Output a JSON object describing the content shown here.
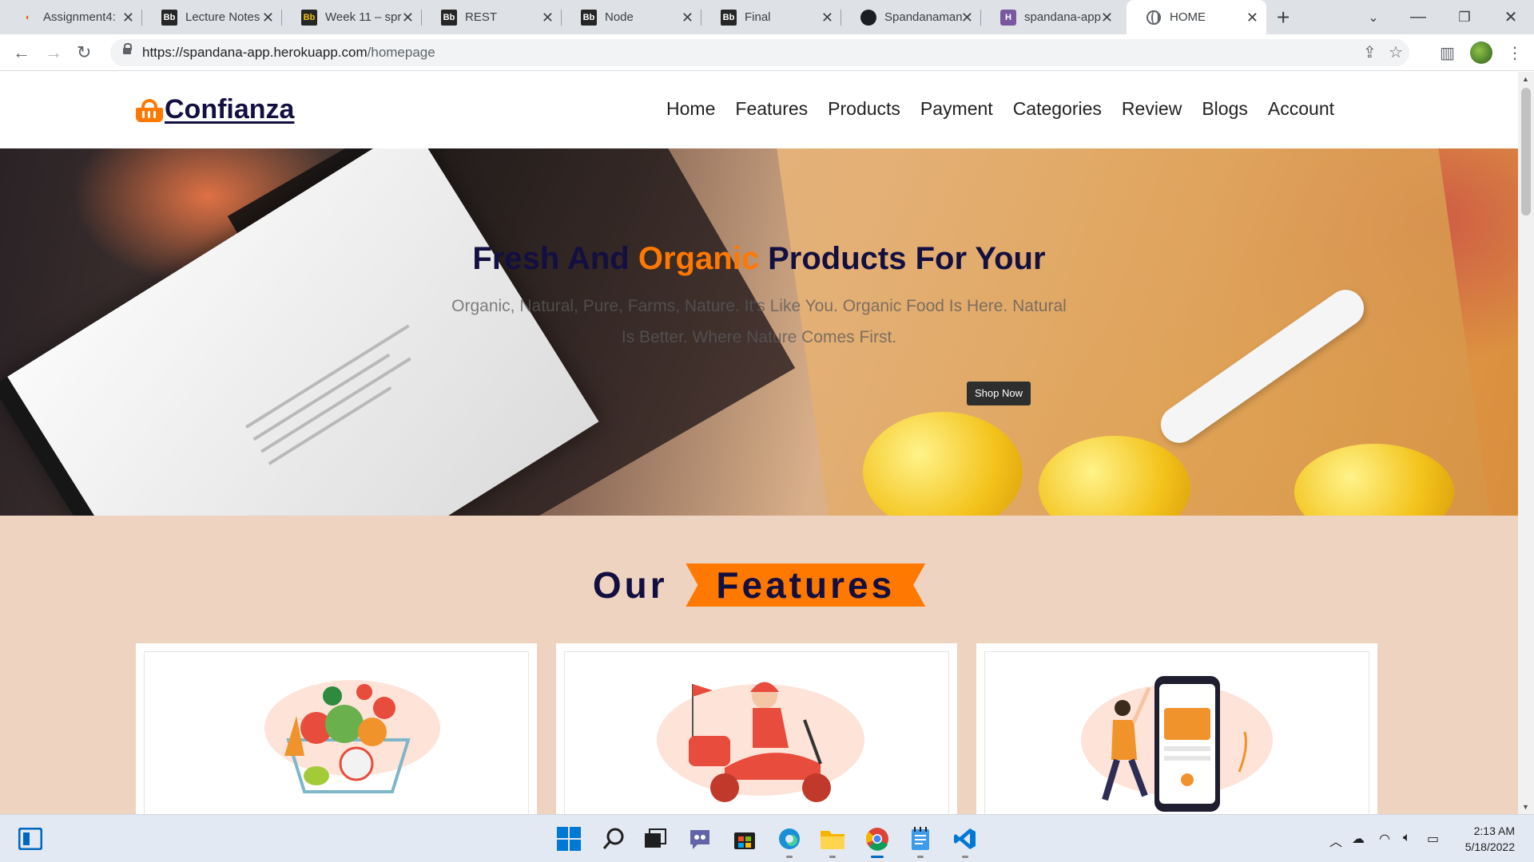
{
  "browser": {
    "tabs": [
      {
        "title": "Assignment4:",
        "icon": "udacity-icon"
      },
      {
        "title": "Lecture Notes",
        "icon": "blackboard-icon"
      },
      {
        "title": "Week 11 – spr",
        "icon": "blackboard-icon"
      },
      {
        "title": "REST",
        "icon": "blackboard-icon"
      },
      {
        "title": "Node",
        "icon": "blackboard-icon"
      },
      {
        "title": "Final",
        "icon": "blackboard-icon"
      },
      {
        "title": "Spandanaman",
        "icon": "github-icon"
      },
      {
        "title": "spandana-app",
        "icon": "heroku-icon"
      },
      {
        "title": "HOME",
        "icon": "globe-icon",
        "active": true
      }
    ],
    "url_host": "https://spandana-app.herokuapp.com",
    "url_path": "/homepage"
  },
  "site": {
    "logo": "Confianza",
    "nav": [
      "Home",
      "Features",
      "Products",
      "Payment",
      "Categories",
      "Review",
      "Blogs",
      "Account"
    ],
    "hero": {
      "title_part1": "Fresh And ",
      "title_accent": "Organic",
      "title_part2": " Products For Your",
      "subtitle": "Organic, Natural, Pure, Farms, Nature. It's Like You. Organic Food Is Here. Natural Is Better. Where Nature Comes First.",
      "button": "Shop Now"
    },
    "features": {
      "heading_word1": "Our",
      "heading_word2": "Features"
    }
  },
  "colors": {
    "accent": "#ff7800",
    "brand_dark": "#130f40",
    "features_bg": "#eed3c1"
  },
  "taskbar": {
    "apps": [
      "start-icon",
      "search-icon",
      "task-view-icon",
      "teams-chat-icon",
      "store-icon",
      "edge-icon",
      "file-explorer-icon",
      "chrome-icon",
      "notepad-icon",
      "vscode-icon"
    ],
    "time": "2:13 AM",
    "date": "5/18/2022"
  }
}
